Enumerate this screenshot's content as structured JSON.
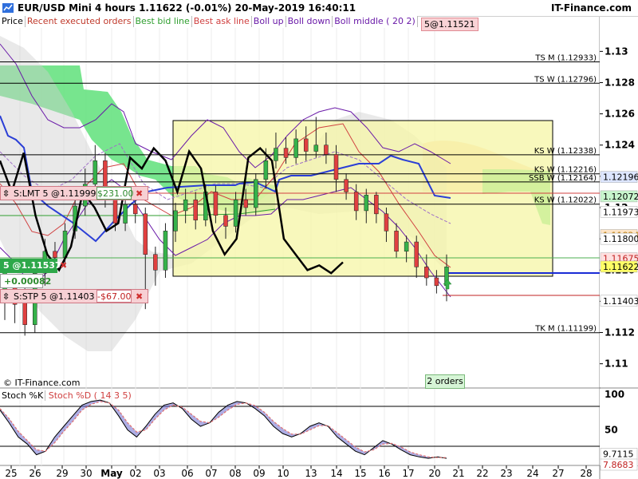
{
  "header": {
    "title": "EUR/USD Mini   4 hours    1.11622 (-0.01%)    20-May-2019 16:40:11",
    "brand": "IT-Finance.com",
    "chart_icon": "chart-icon"
  },
  "legend": [
    {
      "label": "Price",
      "color": "#000000",
      "bg": "#ffffff"
    },
    {
      "label": "Recent executed orders",
      "color": "#c0392b",
      "bg": "#ffffff"
    },
    {
      "label": "Best bid line",
      "color": "#2e9e2e",
      "bg": "#ffffff"
    },
    {
      "label": "Best ask line",
      "color": "#d04040",
      "bg": "#ffffff"
    },
    {
      "label": "Boll up",
      "color": "#6a1aa8",
      "bg": "#ffffff"
    },
    {
      "label": "Boll down",
      "color": "#6a1aa8",
      "bg": "#ffffff"
    },
    {
      "label": "Boll middle  ( 20 2)",
      "color": "#6a1aa8",
      "bg": "#ffffff"
    }
  ],
  "last_order_badge": "5@1.11521",
  "orders": {
    "limit": {
      "label": "S:LMT  5 @1.11999",
      "pnl": "$231.00",
      "close": "✖"
    },
    "position": {
      "label": "5 @1.11537",
      "change": "+0.00082",
      "close": "✖"
    },
    "stop": {
      "label": "S:STP  5 @1.11403",
      "pnl": "-$67.00",
      "close": "✖"
    }
  },
  "orders_badge": "2 orders",
  "copyright": "© IT-Finance.com",
  "stoch_legend": {
    "k": "Stoch %K",
    "d": "Stoch %D  ( 14 3 5)"
  },
  "colors": {
    "bid": "#2e9e2e",
    "ask": "#d04040",
    "boll": "#6a1aa8",
    "price": "#000000",
    "kijun": "#2b3fd6",
    "cloud_green": "#5fe07a",
    "cloud_orange": "#ffc48a",
    "box_fill": "#f6f6a6"
  },
  "chart_data": {
    "type": "line",
    "price_axis": {
      "range": [
        1.1085,
        1.1315
      ],
      "ticks": [
        {
          "value": 1.13,
          "label": "1.13"
        },
        {
          "value": 1.128,
          "label": "1.128"
        },
        {
          "value": 1.126,
          "label": "1.126"
        },
        {
          "value": 1.124,
          "label": "1.124"
        },
        {
          "value": 1.122,
          "label": "1.122"
        },
        {
          "value": 1.12,
          "label": "1.12"
        },
        {
          "value": 1.118,
          "label": "1.118"
        },
        {
          "value": 1.116,
          "label": "1.116"
        },
        {
          "value": 1.114,
          "label": "1.114"
        },
        {
          "value": 1.112,
          "label": "1.112"
        },
        {
          "value": 1.11,
          "label": "1.11"
        }
      ]
    },
    "levels": [
      {
        "label": "TS M (1.12933)",
        "value": 1.12933,
        "color": "#000000"
      },
      {
        "label": "TS W (1.12796)",
        "value": 1.12796,
        "color": "#000000"
      },
      {
        "label": "KS W (1.12338)",
        "value": 1.12338,
        "color": "#000000"
      },
      {
        "label": "KS W (1.12216)",
        "value": 1.12216,
        "color": "#000000"
      },
      {
        "label": "SSB W (1.12164)",
        "value": 1.12164,
        "color": "#000000"
      },
      {
        "label": "KS W (1.12022)",
        "value": 1.12022,
        "color": "#000000"
      },
      {
        "label": "TK M (1.11199)",
        "value": 1.11199,
        "color": "#000000"
      }
    ],
    "price_tags": [
      {
        "label": "1.12196",
        "value": 1.12196,
        "bg": "#dde6ff",
        "fg": "#000000"
      },
      {
        "label": "1.12072",
        "value": 1.12072,
        "bg": "#c8f5cd",
        "fg": "#000000"
      },
      {
        "label": "1.11973",
        "value": 1.11973,
        "bg": "#ffffff",
        "fg": "#000000"
      },
      {
        "label": "1.11824",
        "value": 1.11824,
        "bg": "#ffe6c8",
        "fg": "#bb7a00"
      },
      {
        "label": "1.11800",
        "value": 1.118,
        "bg": "#ffffff",
        "fg": "#000000"
      },
      {
        "label": "1.11675",
        "value": 1.11675,
        "bg": "#ffe0e0",
        "fg": "#c02020"
      },
      {
        "label": "1.11622",
        "value": 1.11622,
        "bg": "#ffff66",
        "fg": "#000000"
      },
      {
        "label": "1.11403",
        "value": 1.11403,
        "bg": "#ffffff",
        "fg": "#000000"
      }
    ],
    "x_labels": [
      "25",
      "26",
      "29",
      "30",
      "May",
      "02",
      "03",
      "06",
      "07",
      "08",
      "09",
      "10",
      "13",
      "14",
      "15",
      "16",
      "17",
      "20",
      "21",
      "22",
      "23",
      "24",
      "27",
      "28"
    ],
    "stoch_axis": {
      "range": [
        0,
        100
      ],
      "ticks": [
        {
          "value": 100,
          "label": "100"
        },
        {
          "value": 50,
          "label": "50"
        }
      ]
    },
    "stoch_tags": [
      {
        "label": "9.7115",
        "value": 9.7115
      },
      {
        "label": "7.8683",
        "value": 7.8683
      }
    ],
    "stoch_levels": [
      80,
      20
    ],
    "candles": [
      [
        1.1145,
        1.1162,
        1.1128,
        1.115
      ],
      [
        1.115,
        1.1138,
        1.1126,
        1.1148
      ],
      [
        1.114,
        1.1125,
        1.1118,
        1.115
      ],
      [
        1.1125,
        1.1158,
        1.112,
        1.1165
      ],
      [
        1.1158,
        1.1172,
        1.115,
        1.118
      ],
      [
        1.1172,
        1.1168,
        1.116,
        1.1178
      ],
      [
        1.1168,
        1.1185,
        1.1162,
        1.119
      ],
      [
        1.1185,
        1.1201,
        1.118,
        1.121
      ],
      [
        1.1201,
        1.1215,
        1.1195,
        1.1225
      ],
      [
        1.1215,
        1.123,
        1.1205,
        1.124
      ],
      [
        1.123,
        1.1205,
        1.12,
        1.1235
      ],
      [
        1.1205,
        1.119,
        1.1185,
        1.1212
      ],
      [
        1.119,
        1.1202,
        1.1185,
        1.121
      ],
      [
        1.1202,
        1.1196,
        1.119,
        1.1208
      ],
      [
        1.1196,
        1.117,
        1.1135,
        1.12
      ],
      [
        1.117,
        1.116,
        1.115,
        1.1175
      ],
      [
        1.116,
        1.1185,
        1.1155,
        1.119
      ],
      [
        1.1185,
        1.1198,
        1.1178,
        1.1203
      ],
      [
        1.1198,
        1.1205,
        1.119,
        1.1212
      ],
      [
        1.1205,
        1.1192,
        1.1186,
        1.121
      ],
      [
        1.1192,
        1.121,
        1.1188,
        1.1215
      ],
      [
        1.121,
        1.1195,
        1.119,
        1.1214
      ],
      [
        1.1195,
        1.1188,
        1.118,
        1.12
      ],
      [
        1.1188,
        1.1205,
        1.1184,
        1.121
      ],
      [
        1.1205,
        1.12,
        1.1195,
        1.1212
      ],
      [
        1.12,
        1.1218,
        1.1195,
        1.1222
      ],
      [
        1.1218,
        1.123,
        1.1212,
        1.1238
      ],
      [
        1.123,
        1.1238,
        1.1225,
        1.1248
      ],
      [
        1.1238,
        1.1232,
        1.1228,
        1.1245
      ],
      [
        1.1232,
        1.1244,
        1.1228,
        1.125
      ],
      [
        1.1244,
        1.1236,
        1.123,
        1.1252
      ],
      [
        1.1236,
        1.124,
        1.1232,
        1.1258
      ],
      [
        1.124,
        1.1234,
        1.1228,
        1.1248
      ],
      [
        1.1234,
        1.1218,
        1.121,
        1.124
      ],
      [
        1.1218,
        1.121,
        1.1205,
        1.1222
      ],
      [
        1.121,
        1.1198,
        1.1192,
        1.1215
      ],
      [
        1.1198,
        1.1208,
        1.119,
        1.1212
      ],
      [
        1.1208,
        1.1196,
        1.119,
        1.121
      ],
      [
        1.1196,
        1.1185,
        1.1178,
        1.12
      ],
      [
        1.1185,
        1.1172,
        1.1168,
        1.119
      ],
      [
        1.1172,
        1.1178,
        1.1165,
        1.1182
      ],
      [
        1.1178,
        1.1162,
        1.1155,
        1.1182
      ],
      [
        1.1162,
        1.1155,
        1.115,
        1.117
      ],
      [
        1.1155,
        1.115,
        1.1145,
        1.116
      ],
      [
        1.115,
        1.1162,
        1.114,
        1.117
      ]
    ],
    "price_line": [
      1.123,
      1.121,
      1.1235,
      1.1195,
      1.117,
      1.116,
      1.1175,
      1.121,
      1.12,
      1.1185,
      1.119,
      1.1232,
      1.1225,
      1.1238,
      1.123,
      1.121,
      1.1236,
      1.1225,
      1.1185,
      1.117,
      1.118,
      1.1232,
      1.1238,
      1.123,
      1.118,
      1.117,
      1.116,
      1.1163,
      1.1158,
      1.1165
    ],
    "kijun_line": [
      1.119,
      1.1205,
      1.1205,
      1.1175,
      1.1195,
      1.1196,
      1.1196,
      1.118,
      1.1185,
      1.1185,
      1.1222,
      1.1222,
      1.1222,
      1.1218,
      1.1218,
      1.1214,
      1.1205,
      1.1201,
      1.1199,
      1.1199
    ],
    "stoch_k": [
      78,
      60,
      40,
      30,
      15,
      20,
      40,
      55,
      70,
      85,
      90,
      92,
      88,
      70,
      50,
      40,
      55,
      72,
      85,
      88,
      80,
      65,
      55,
      60,
      75,
      85,
      90,
      88,
      80,
      70,
      55,
      45,
      40,
      45,
      55,
      60,
      55,
      40,
      30,
      20,
      15,
      25,
      35,
      30,
      22,
      15,
      12,
      10,
      12,
      10
    ],
    "stoch_d": [
      80,
      66,
      48,
      35,
      22,
      20,
      32,
      48,
      62,
      78,
      86,
      90,
      88,
      78,
      60,
      47,
      50,
      65,
      78,
      85,
      82,
      72,
      62,
      60,
      68,
      78,
      86,
      88,
      84,
      75,
      62,
      52,
      44,
      44,
      50,
      56,
      56,
      46,
      36,
      26,
      19,
      22,
      30,
      31,
      26,
      19,
      15,
      12,
      11,
      11
    ]
  }
}
